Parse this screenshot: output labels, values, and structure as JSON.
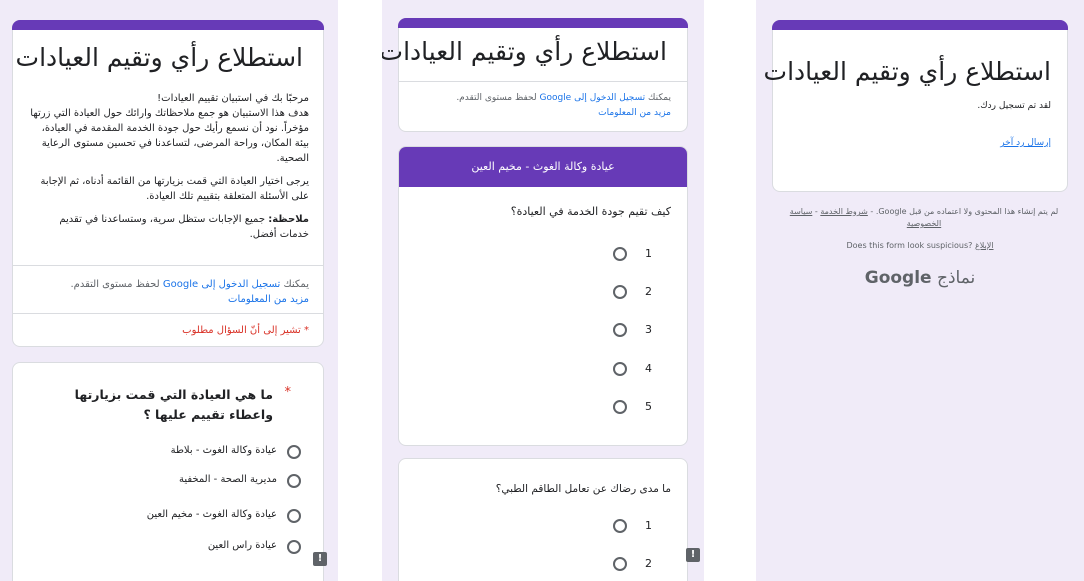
{
  "form_title": "استطلاع رأي وتقيم العيادات",
  "left_panel": {
    "intro": [
      "مرحبًا بك في استبيان تقييم العيادات!",
      "هدف هذا الاستبيان هو جمع ملاحظاتك وارائك حول العيادة التي زرتها مؤخراً. نود أن نسمع رأيك حول جودة الخدمة المقدمة في العيادة، بيئة المكان، وراحة المرضى، لتساعدنا في تحسين مستوى الرعاية الصحية."
    ],
    "instruction": "يرجى اختيار العيادة التي قمت بزيارتها من القائمة أدناه، ثم الإجابة على الأسئلة المتعلقة بتقييم تلك العيادة.",
    "note_label": "ملاحظة:",
    "note_text": " جميع الإجابات ستظل سرية، وستساعدنا في تقديم خدمات أفضل.",
    "signin_prefix": "يمكنك ",
    "signin_link": "تسجيل الدخول إلى Google",
    "signin_suffix": " لحفظ مستوى التقدم.",
    "learn_more": "مزيد من المعلومات",
    "required_note": "* تشير إلى أنّ السؤال مطلوب",
    "question": "ما هي العيادة التي قمت بزيارتها واعطاء تقييم عليها ؟",
    "required_star": "*",
    "options": [
      "عيادة وكالة الغوث - بلاطة",
      "مديرية الصحة - المخفية",
      "عيادة وكالة الغوث - مخيم العين",
      "عيادة راس العين"
    ]
  },
  "middle_panel": {
    "signin_prefix": "يمكنك ",
    "signin_link": "تسجيل الدخول إلى Google",
    "signin_suffix": " لحفظ مستوى التقدم.",
    "learn_more": "مزيد من المعلومات",
    "section_title": "عيادة وكالة الغوث - مخيم العين",
    "question1": "كيف تقيم جودة الخدمة في العيادة؟",
    "q1_options": [
      "1",
      "2",
      "3",
      "4",
      "5"
    ],
    "question2": "ما مدى رضاك عن تعامل الطاقم الطبي؟",
    "q2_options": [
      "1",
      "2"
    ]
  },
  "right_panel": {
    "confirmation": "لقد تم تسجيل ردك.",
    "another_response": "إرسال رد آخر",
    "footer_prefix": "لم يتم إنشاء هذا المحتوى ولا اعتماده من قبل Google. - ",
    "terms_link": "شروط الخدمة",
    "footer_sep": " - ",
    "privacy_link": "سياسة الخصوصية",
    "suspicious_text": "Does this form look suspicious? ",
    "report_link": "الإبلاغ",
    "forms_word": "نماذج ",
    "google_word": "Google"
  },
  "colors": {
    "accent": "#673ab7",
    "background": "#f0ebf8",
    "link": "#1a73e8",
    "required": "#d93025"
  },
  "icons": {
    "feedback": "report-icon"
  }
}
